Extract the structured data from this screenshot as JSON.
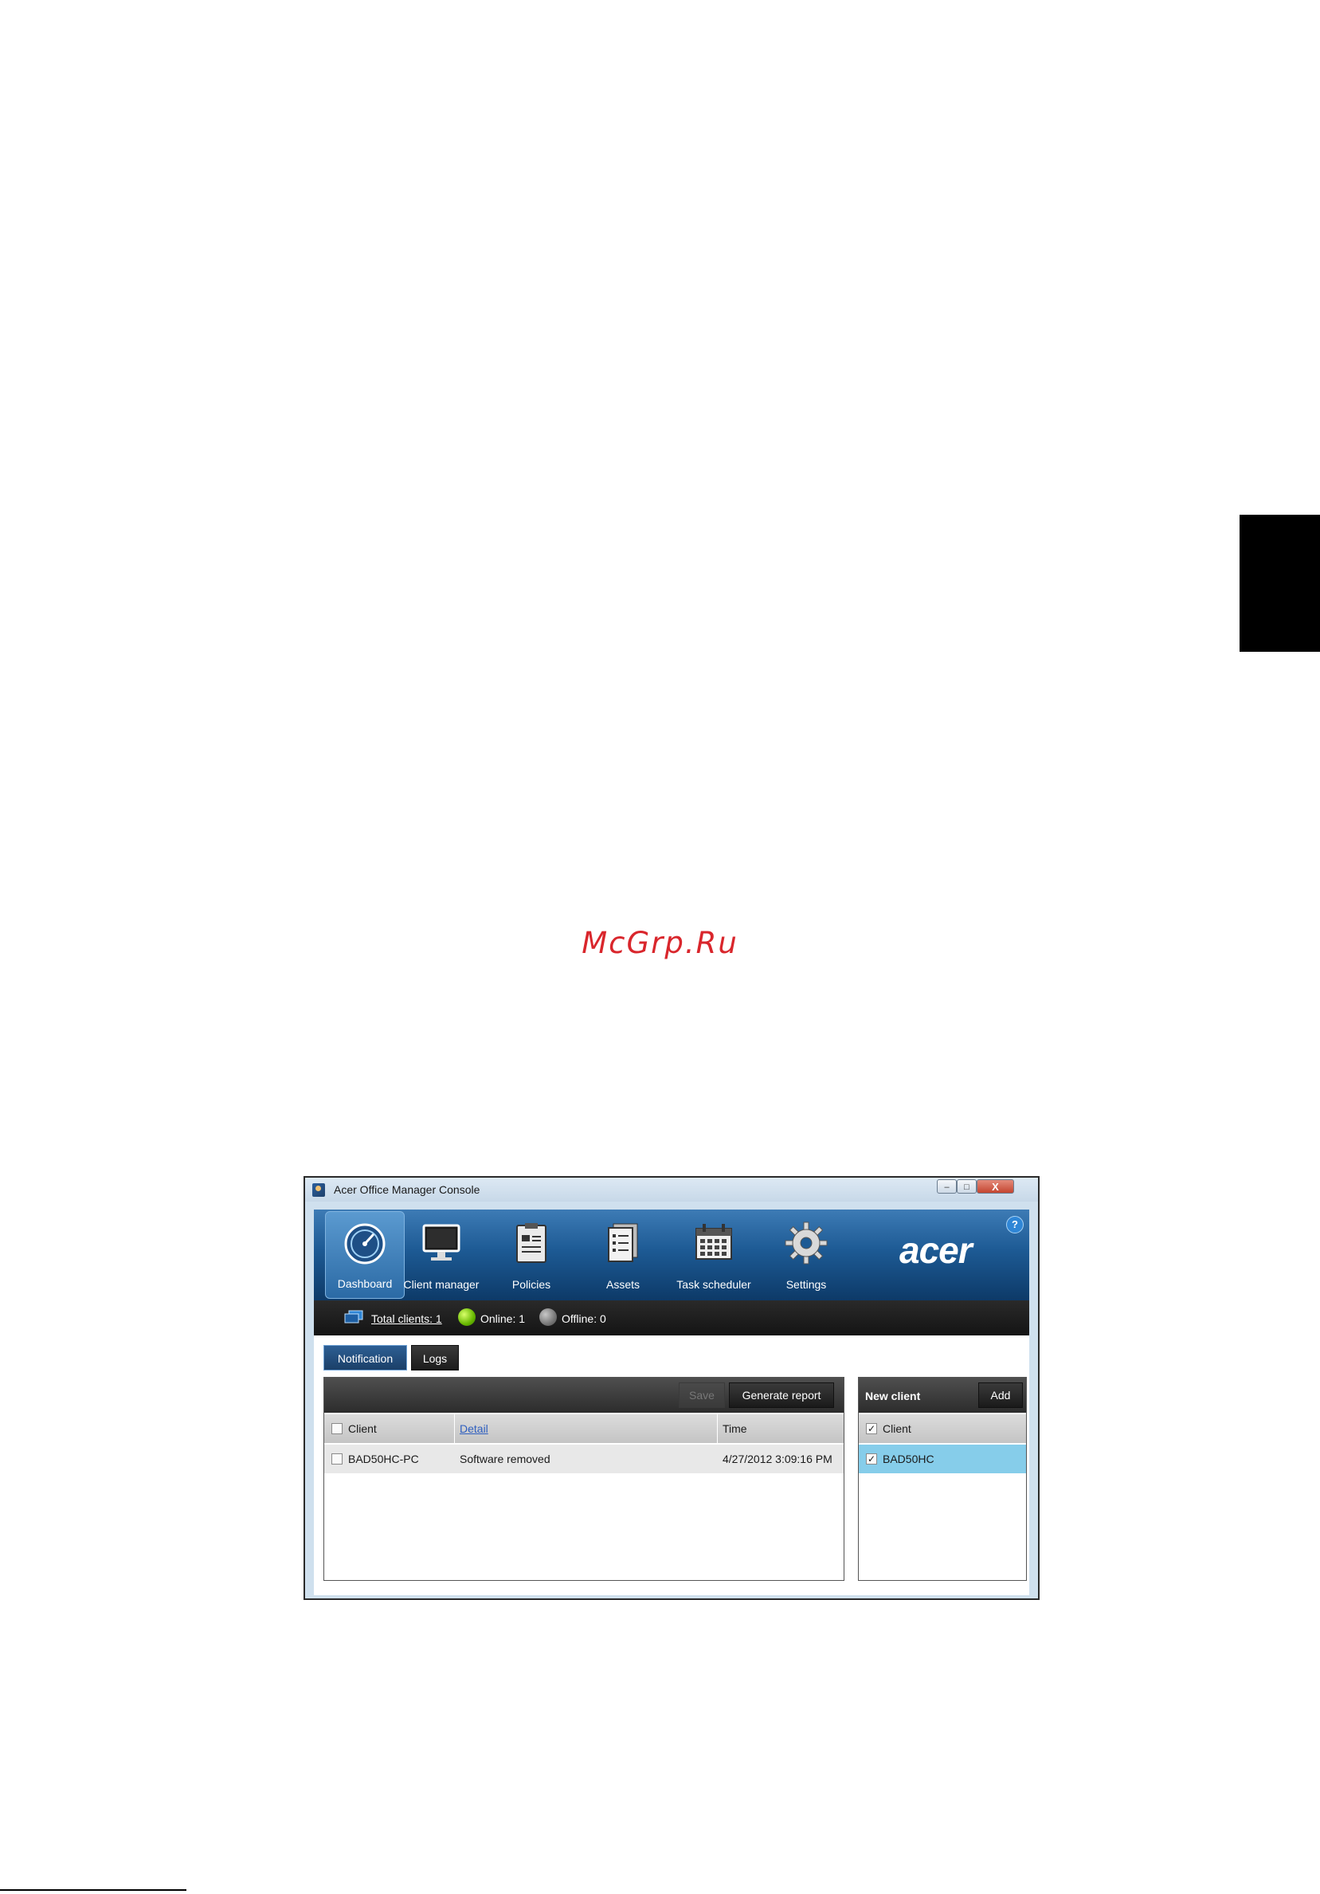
{
  "page": {
    "watermark": "McGrp.Ru"
  },
  "window": {
    "title": "Acer Office Manager Console",
    "controls": {
      "minimize": "–",
      "maximize": "□",
      "close": "X"
    }
  },
  "nav": {
    "items": [
      {
        "label": "Dashboard",
        "icon": "dashboard-icon",
        "active": true
      },
      {
        "label": "Client manager",
        "icon": "monitor-icon",
        "active": false
      },
      {
        "label": "Policies",
        "icon": "clipboard-icon",
        "active": false
      },
      {
        "label": "Assets",
        "icon": "document-list-icon",
        "active": false
      },
      {
        "label": "Task scheduler",
        "icon": "calendar-icon",
        "active": false
      },
      {
        "label": "Settings",
        "icon": "gear-icon",
        "active": false
      }
    ],
    "brand": "acer",
    "help": "?"
  },
  "status": {
    "total": "Total clients: 1",
    "online": "Online: 1",
    "offline": "Offline: 0",
    "colors": {
      "online": "#67b800",
      "offline": "#777777"
    }
  },
  "tabs": {
    "notification": "Notification",
    "logs": "Logs"
  },
  "notifications": {
    "save_label": "Save",
    "report_label": "Generate report",
    "columns": [
      "Client",
      "Detail",
      "Time"
    ],
    "rows": [
      {
        "client": "BAD50HC-PC",
        "detail": "Software removed",
        "time": "4/27/2012 3:09:16 PM"
      }
    ]
  },
  "new_client": {
    "title": "New client",
    "add_label": "Add",
    "column": "Client",
    "rows": [
      {
        "client": "BAD50HC",
        "checked": true
      }
    ]
  }
}
